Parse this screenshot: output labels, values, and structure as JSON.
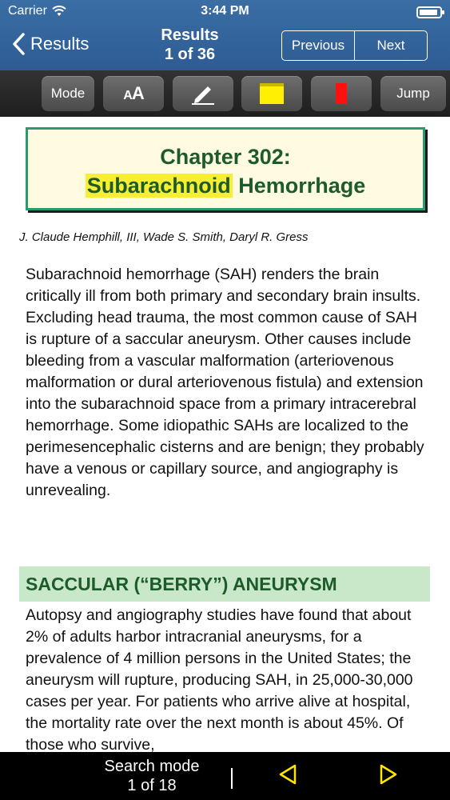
{
  "status": {
    "carrier": "Carrier",
    "time": "3:44 PM"
  },
  "nav": {
    "back_label": "Results",
    "title": "Results",
    "subtitle": "1 of 36",
    "previous_label": "Previous",
    "next_label": "Next"
  },
  "toolbar": {
    "mode_label": "Mode",
    "font_label": "AA",
    "jump_label": "Jump",
    "colors": {
      "highlight": "#ffef00",
      "bookmark": "#ff1010"
    }
  },
  "document": {
    "chapter_prefix": "Chapter 302:",
    "chapter_highlight": "Subarachnoid",
    "chapter_rest": " Hemorrhage",
    "authors": "J. Claude Hemphill, III, Wade S. Smith, Daryl R. Gress",
    "paragraph1": "Subarachnoid hemorrhage (SAH) renders the brain critically ill from both primary and secondary brain insults. Excluding head trauma, the most common cause of SAH is rupture of a saccular aneurysm. Other causes include bleeding from a vascular malformation (arteriovenous malformation or dural arteriovenous fistula) and extension into the subarachnoid space from a primary intracerebral hemorrhage. Some idiopathic SAHs are localized to the perimesencephalic cisterns and are benign; they probably have a venous or capillary source, and angiography is unrevealing.",
    "section_heading": "SACCULAR (“BERRY”) ANEURYSM",
    "paragraph2": "Autopsy and angiography studies have found that about 2% of adults harbor intracranial aneurysms, for a prevalence of 4 million persons in the United States; the aneurysm will rupture, producing SAH, in 25,000-30,000 cases per year. For patients who arrive alive at hospital, the mortality rate over the next month is about 45%. Of those who survive,"
  },
  "bottom": {
    "search_mode_label": "Search mode",
    "search_count": "1 of 18",
    "arrow_color": "#ffe600"
  }
}
